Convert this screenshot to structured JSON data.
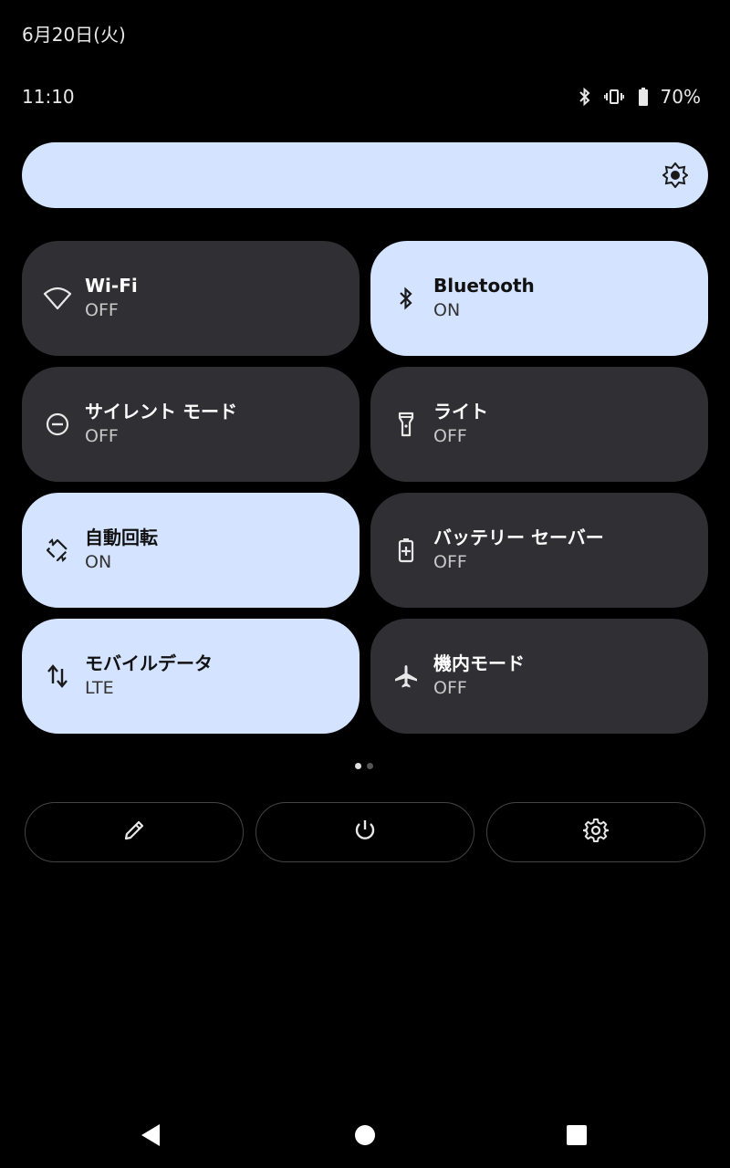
{
  "status_bar": {
    "date": "6月20日(火)",
    "time": "11:10",
    "icons": [
      "bluetooth-icon",
      "vibrate-icon",
      "battery-icon"
    ],
    "battery_percent": "70%"
  },
  "brightness": {
    "icon": "brightness-icon",
    "accent": "#d4e3ff"
  },
  "tiles": [
    {
      "label": "Wi-Fi",
      "state": "OFF",
      "icon": "wifi-icon",
      "on": false
    },
    {
      "label": "Bluetooth",
      "state": "ON",
      "icon": "bluetooth-icon",
      "on": true
    },
    {
      "label": "サイレント モード",
      "state": "OFF",
      "icon": "do-not-disturb-icon",
      "on": false
    },
    {
      "label": "ライト",
      "state": "OFF",
      "icon": "flashlight-icon",
      "on": false
    },
    {
      "label": "自動回転",
      "state": "ON",
      "icon": "auto-rotate-icon",
      "on": true
    },
    {
      "label": "バッテリー セーバー",
      "state": "OFF",
      "icon": "battery-saver-icon",
      "on": false
    },
    {
      "label": "モバイルデータ",
      "state": "LTE",
      "icon": "mobile-data-icon",
      "on": true
    },
    {
      "label": "機内モード",
      "state": "OFF",
      "icon": "airplane-icon",
      "on": false
    }
  ],
  "pager": {
    "pages": 2,
    "current": 1
  },
  "actions": [
    "edit-icon",
    "power-icon",
    "settings-icon"
  ],
  "nav": [
    "back-icon",
    "home-icon",
    "recents-icon"
  ],
  "colors": {
    "tile_on": "#d4e3ff",
    "tile_off": "#303034",
    "background": "#000000"
  }
}
